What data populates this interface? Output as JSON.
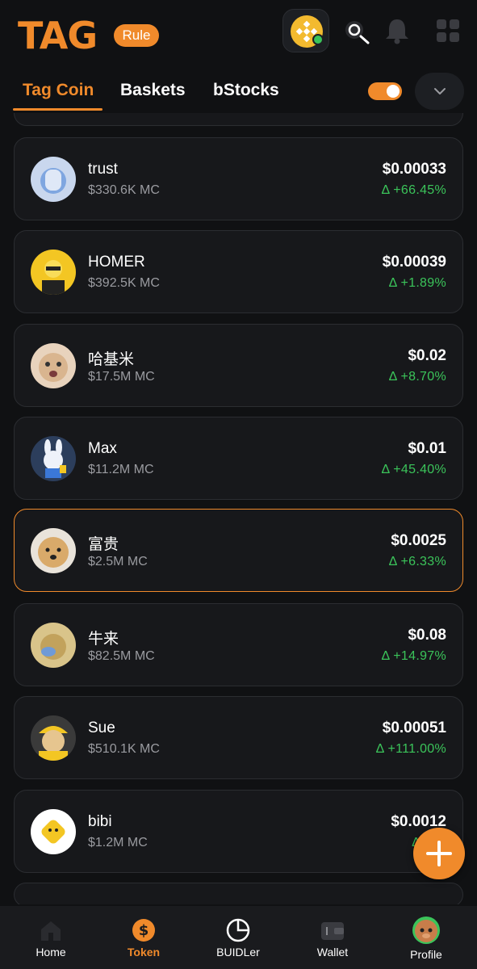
{
  "header": {
    "logo_text": "TAG",
    "rule_label": "Rule",
    "accent_color": "#f08a2b",
    "icons": [
      "bnb-chain-icon",
      "search-icon",
      "bell-icon",
      "grid-icon"
    ]
  },
  "tabs": [
    {
      "label": "Tag Coin",
      "active": true
    },
    {
      "label": "Baskets",
      "active": false
    },
    {
      "label": "bStocks",
      "active": false
    }
  ],
  "toggle": {
    "on": true
  },
  "tokens": [
    {
      "name": "trust",
      "mc": "$330.6K MC",
      "price": "$0.00033",
      "change": "Δ +66.45%"
    },
    {
      "name": "HOMER",
      "mc": "$392.5K MC",
      "price": "$0.00039",
      "change": "Δ +1.89%"
    },
    {
      "name": "哈基米",
      "mc": "$17.5M MC",
      "price": "$0.02",
      "change": "Δ +8.70%"
    },
    {
      "name": "Max",
      "mc": "$11.2M MC",
      "price": "$0.01",
      "change": "Δ +45.40%"
    },
    {
      "name": "富贵",
      "mc": "$2.5M MC",
      "price": "$0.0025",
      "change": "Δ +6.33%",
      "highlighted": true
    },
    {
      "name": "牛来",
      "mc": "$82.5M MC",
      "price": "$0.08",
      "change": "Δ +14.97%"
    },
    {
      "name": "Sue",
      "mc": "$510.1K MC",
      "price": "$0.00051",
      "change": "Δ +111.00%"
    },
    {
      "name": "bibi",
      "mc": "$1.2M MC",
      "price": "$0.0012",
      "change": "Δ +15"
    }
  ],
  "nav": [
    {
      "label": "Home",
      "icon": "home-icon",
      "active": false
    },
    {
      "label": "Token",
      "icon": "dollar-icon",
      "active": true
    },
    {
      "label": "BUIDLer",
      "icon": "pie-chart-icon",
      "active": false
    },
    {
      "label": "Wallet",
      "icon": "wallet-icon",
      "active": false
    },
    {
      "label": "Profile",
      "icon": "profile-avatar",
      "active": false
    }
  ],
  "colors": {
    "positive": "#3bc45a",
    "card_bg": "#17181b",
    "page_bg": "#101113"
  }
}
